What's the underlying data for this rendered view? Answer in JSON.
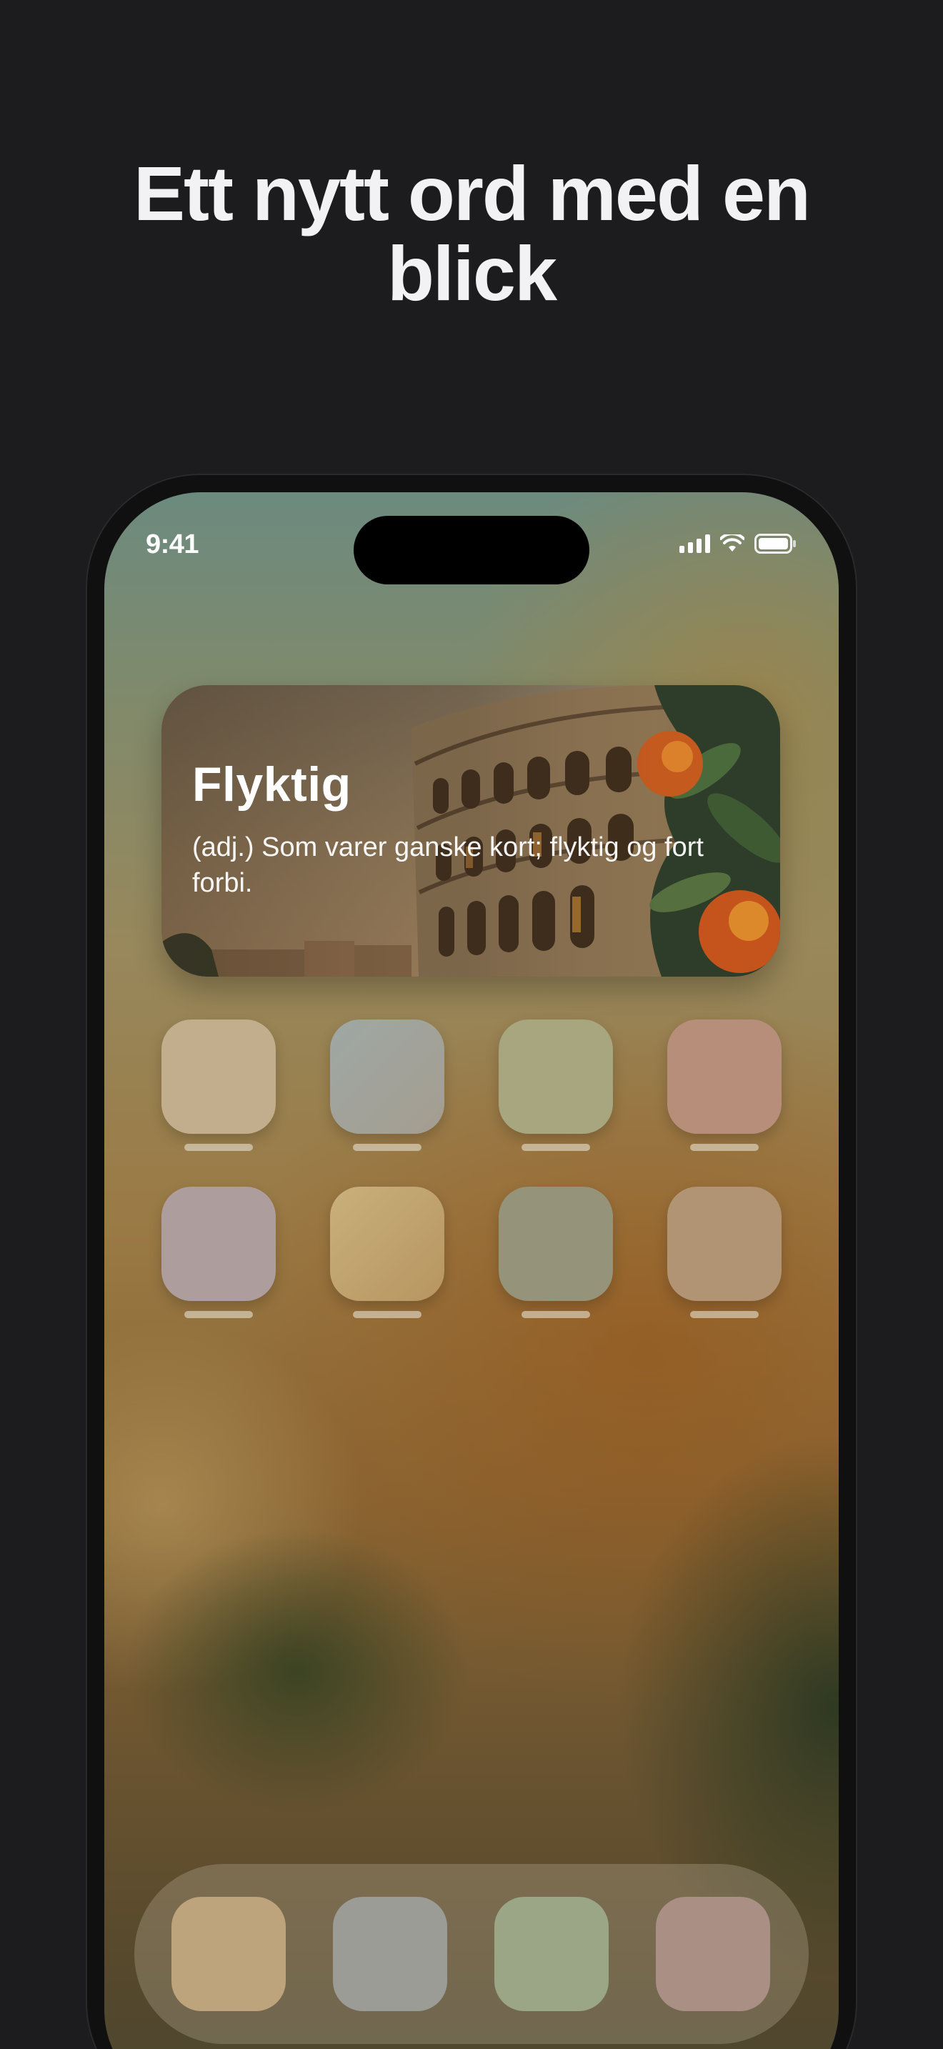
{
  "headline": {
    "line1": "Ett nytt ord med en",
    "line2": "blick"
  },
  "status_bar": {
    "time": "9:41",
    "icons": [
      "cellular-signal-icon",
      "wifi-icon",
      "battery-icon"
    ]
  },
  "widget": {
    "word": "Flyktig",
    "definition": "(adj.) Som varer ganske kort; flyktig og fort forbi.",
    "background_art": "colosseum-illustration"
  },
  "app_grid": {
    "row1_colors": [
      "#c2ae8c",
      "#a1a39d",
      "#a7a67f",
      "#b78e7a"
    ],
    "row2_colors": [
      "#ad9e9d",
      "#c4a877",
      "#95937a",
      "#b19473"
    ]
  },
  "dock": {
    "colors": [
      "#bea47d",
      "#9c9c96",
      "#9aa686",
      "#a98f84"
    ]
  }
}
